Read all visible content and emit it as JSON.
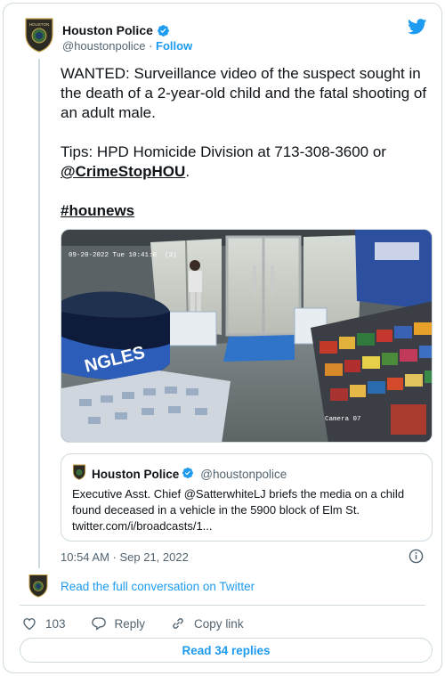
{
  "author": {
    "name": "Houston Police",
    "handle": "@houstonpolice",
    "follow_label": "Follow",
    "separator": "·"
  },
  "tweet": {
    "paragraph1": "WANTED: Surveillance video of the suspect sought in the death of a 2-year-old child and the fatal shooting of an adult male.",
    "tips_prefix": "Tips: HPD Homicide Division at 713-308-3600 or ",
    "tips_mention": "@CrimeStopHOU",
    "tips_suffix": ".",
    "hashtag": "#hounews"
  },
  "media": {
    "overlay_timestamp": "09-20-2022 Tue 10:41:0",
    "overlay_channel": "(3)",
    "camera_label": "Camera 07",
    "counter_sign": "NGLES"
  },
  "quote": {
    "name": "Houston Police",
    "handle": "@houstonpolice",
    "text": "Executive Asst. Chief @SatterwhiteLJ briefs the media on a child found deceased in a vehicle in the 5900 block of Elm St. twitter.com/i/broadcasts/1..."
  },
  "meta": {
    "timestamp": "10:54 AM · Sep 21, 2022",
    "read_conversation": "Read the full conversation on Twitter"
  },
  "actions": {
    "like_count": "103",
    "reply_label": "Reply",
    "copy_label": "Copy link",
    "read_replies": "Read 34 replies"
  },
  "colors": {
    "accent": "#1d9bf0",
    "text": "#0f1419",
    "muted": "#536471",
    "border": "#cfd9de"
  }
}
